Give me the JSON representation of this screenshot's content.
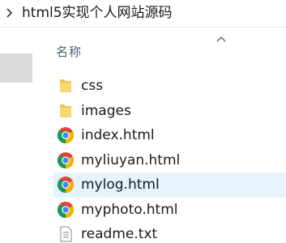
{
  "breadcrumb": {
    "path": "html5实现个人网站源码",
    "chevron_icon": "chevron-right-icon"
  },
  "columns": {
    "name_label": "名称",
    "sort_icon": "sort-up-icon"
  },
  "files": [
    {
      "name": "css",
      "type": "folder",
      "icon": "folder-icon",
      "selected": false
    },
    {
      "name": "images",
      "type": "folder",
      "icon": "folder-icon",
      "selected": false
    },
    {
      "name": "index.html",
      "type": "html",
      "icon": "chrome-html-icon",
      "selected": false
    },
    {
      "name": "myliuyan.html",
      "type": "html",
      "icon": "chrome-html-icon",
      "selected": false
    },
    {
      "name": "mylog.html",
      "type": "html",
      "icon": "chrome-html-icon",
      "selected": true
    },
    {
      "name": "myphoto.html",
      "type": "html",
      "icon": "chrome-html-icon",
      "selected": false
    },
    {
      "name": "readme.txt",
      "type": "text",
      "icon": "text-file-icon",
      "selected": false
    }
  ],
  "colors": {
    "selection": "#e5f3ff",
    "header_text": "#4c607a",
    "folder": "#f2c54a",
    "chrome_red": "#db4437",
    "chrome_yellow": "#f4b400",
    "chrome_green": "#0f9d58",
    "chrome_blue": "#4285f4"
  }
}
